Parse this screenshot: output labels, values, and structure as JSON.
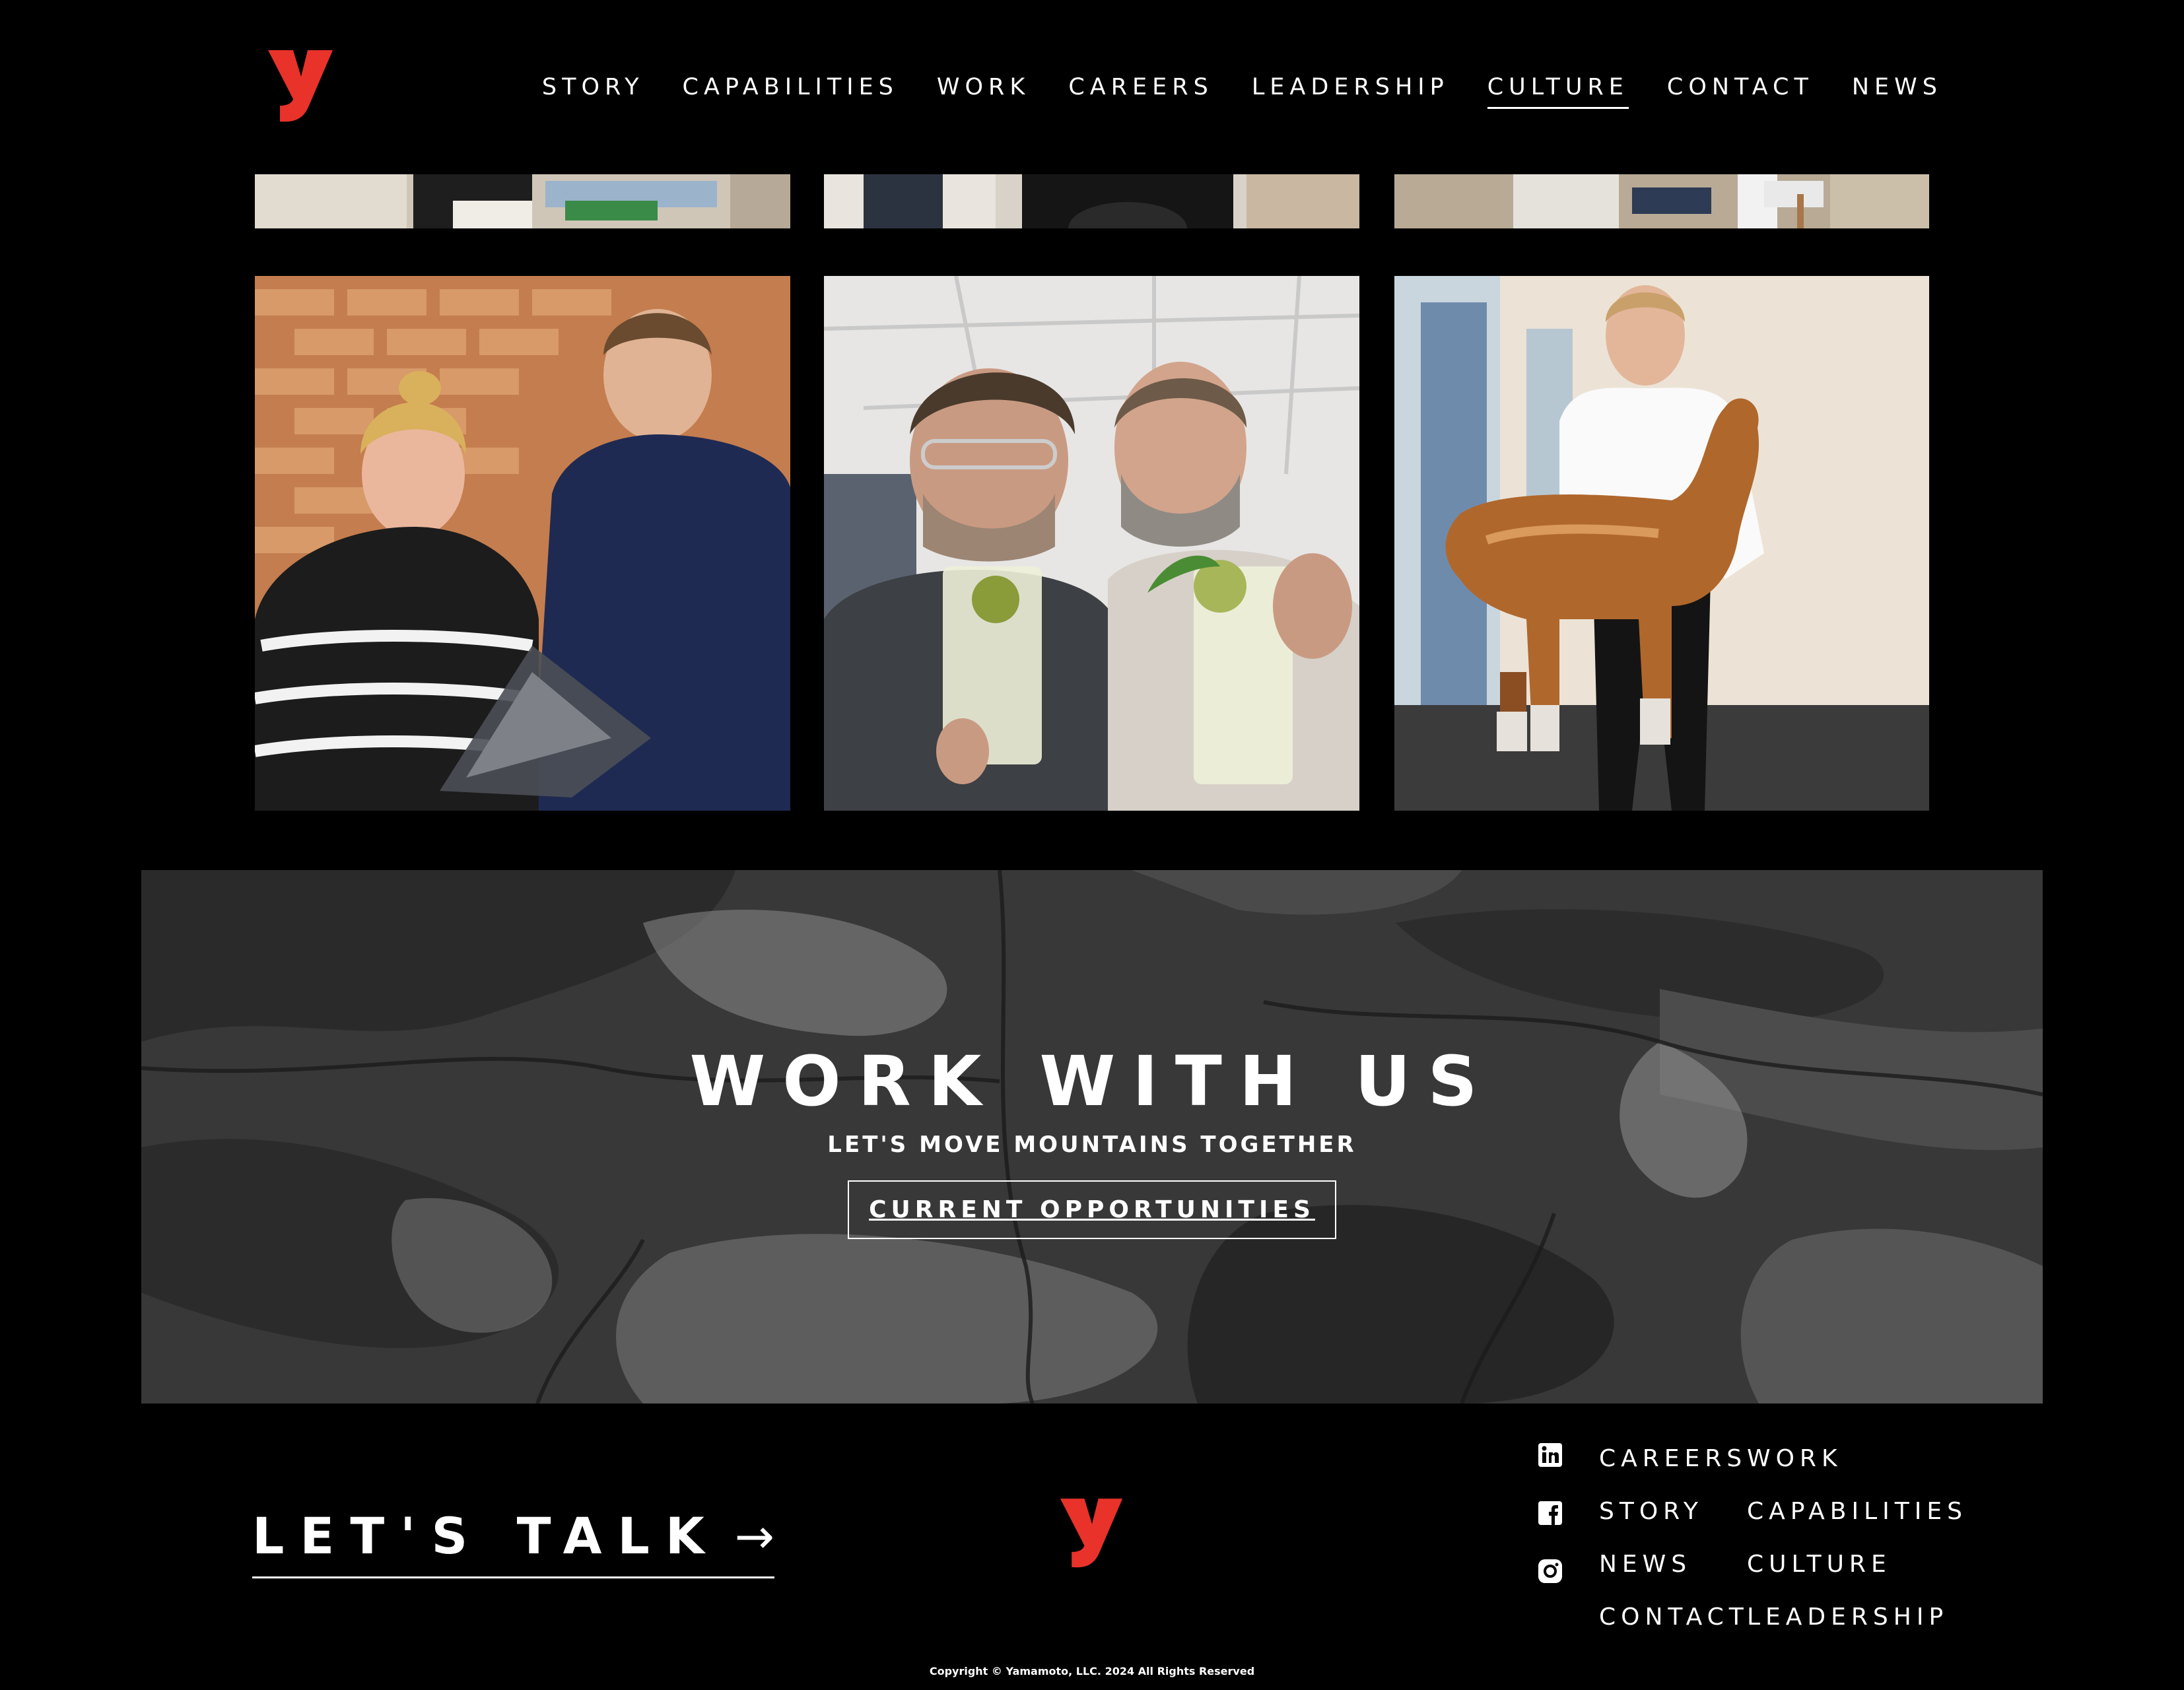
{
  "colors": {
    "brand_red": "#e8322a",
    "background": "#000000",
    "text": "#ffffff"
  },
  "header": {
    "logo_icon": "yamamoto-y-logo",
    "nav": [
      {
        "label": "STORY",
        "active": false
      },
      {
        "label": "CAPABILITIES",
        "active": false
      },
      {
        "label": "WORK",
        "active": false
      },
      {
        "label": "CAREERS",
        "active": false
      },
      {
        "label": "LEADERSHIP",
        "active": false
      },
      {
        "label": "CULTURE",
        "active": true
      },
      {
        "label": "CONTACT",
        "active": false
      },
      {
        "label": "NEWS",
        "active": false
      }
    ]
  },
  "gallery": {
    "photos": [
      {
        "name": "office-meeting-photo"
      },
      {
        "name": "office-person-photo"
      },
      {
        "name": "office-floor-photo"
      },
      {
        "name": "award-photo"
      },
      {
        "name": "drinks-selfie-photo"
      },
      {
        "name": "inflatable-horse-photo"
      }
    ]
  },
  "banner": {
    "title": "WORK WITH US",
    "subtitle": "LET'S MOVE MOUNTAINS TOGETHER",
    "button": "CURRENT OPPORTUNITIES"
  },
  "footer": {
    "talk_label": "LET'S TALK",
    "talk_arrow": "→",
    "social_icons": [
      "linkedin-icon",
      "facebook-icon",
      "instagram-icon"
    ],
    "nav_col1": [
      "CAREERS",
      "STORY",
      "NEWS",
      "CONTACT"
    ],
    "nav_col2": [
      "WORK",
      "CAPABILITIES",
      "CULTURE",
      "LEADERSHIP"
    ],
    "copyright": "Copyright © Yamamoto, LLC. 2024 All Rights Reserved"
  }
}
